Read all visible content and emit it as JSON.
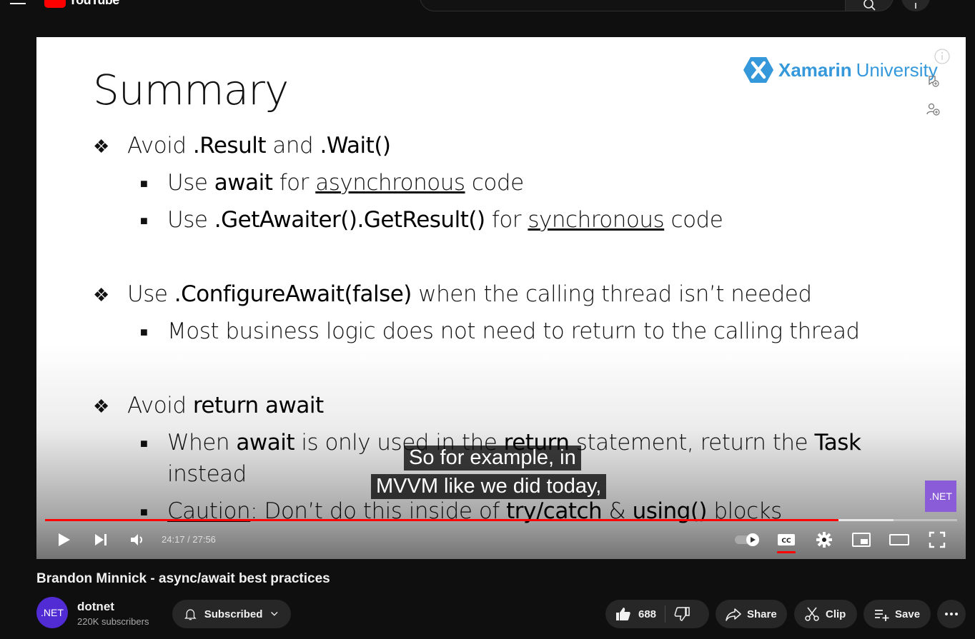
{
  "header": {
    "logo_text": "YouTube",
    "search_placeholder": "Search"
  },
  "slide": {
    "title": "Summary",
    "brand_name": "Xamarin",
    "brand_suffix": "University",
    "items": [
      {
        "level": 1,
        "parts": [
          [
            "t",
            "Avoid "
          ],
          [
            "b",
            ".Result"
          ],
          [
            "t",
            " and "
          ],
          [
            "b",
            ".Wait()"
          ]
        ]
      },
      {
        "level": 2,
        "parts": [
          [
            "t",
            "Use "
          ],
          [
            "b",
            "await"
          ],
          [
            "t",
            " for "
          ],
          [
            "u",
            "asynchronous"
          ],
          [
            "t",
            " code"
          ]
        ]
      },
      {
        "level": 2,
        "parts": [
          [
            "t",
            "Use "
          ],
          [
            "b",
            ".GetAwaiter().GetResult()"
          ],
          [
            "t",
            " for "
          ],
          [
            "u",
            "synchronous"
          ],
          [
            "t",
            " code"
          ]
        ]
      },
      {
        "level": 1,
        "parts": [
          [
            "t",
            "Use "
          ],
          [
            "b",
            ".ConfigureAwait(false)"
          ],
          [
            "t",
            " when the calling thread isn’t needed"
          ]
        ]
      },
      {
        "level": 2,
        "parts": [
          [
            "t",
            "Most business logic does not need to return to the calling thread"
          ]
        ]
      },
      {
        "level": 1,
        "parts": [
          [
            "t",
            "Avoid "
          ],
          [
            "b",
            "return await"
          ]
        ]
      },
      {
        "level": 2,
        "parts": [
          [
            "t",
            "When "
          ],
          [
            "b",
            "await"
          ],
          [
            "t",
            " is only used in the "
          ],
          [
            "b",
            "return"
          ],
          [
            "t",
            " statement, return the "
          ],
          [
            "b",
            "Task"
          ]
        ]
      },
      {
        "level": 3,
        "parts": [
          [
            "t",
            "instead"
          ]
        ]
      },
      {
        "level": 2,
        "parts": [
          [
            "u",
            "Caution"
          ],
          [
            "t",
            ": Don’t do this inside of "
          ],
          [
            "b",
            "try/catch"
          ],
          [
            "t",
            " & "
          ],
          [
            "b",
            "using()"
          ],
          [
            "t",
            " blocks"
          ]
        ]
      }
    ]
  },
  "captions": {
    "line1": "So for example, in",
    "line2": "MVVM like we did today,"
  },
  "player": {
    "badge": ".NET",
    "time_current": "24:17",
    "time_total": "27:56",
    "time_display": "24:17 / 27:56",
    "progress": 0.8698,
    "buffered": 0.93
  },
  "video": {
    "title": "Brandon Minnick - async/await best practices"
  },
  "channel": {
    "avatar_text": ".NET",
    "name": "dotnet",
    "subscribers": "220K subscribers",
    "subscribe_label": "Subscribed"
  },
  "actions": {
    "likes": "688",
    "share": "Share",
    "clip": "Clip",
    "save": "Save"
  },
  "colors": {
    "accent": "#ff0000",
    "xamarin": "#3498db",
    "dotnet": "#512bd4"
  }
}
